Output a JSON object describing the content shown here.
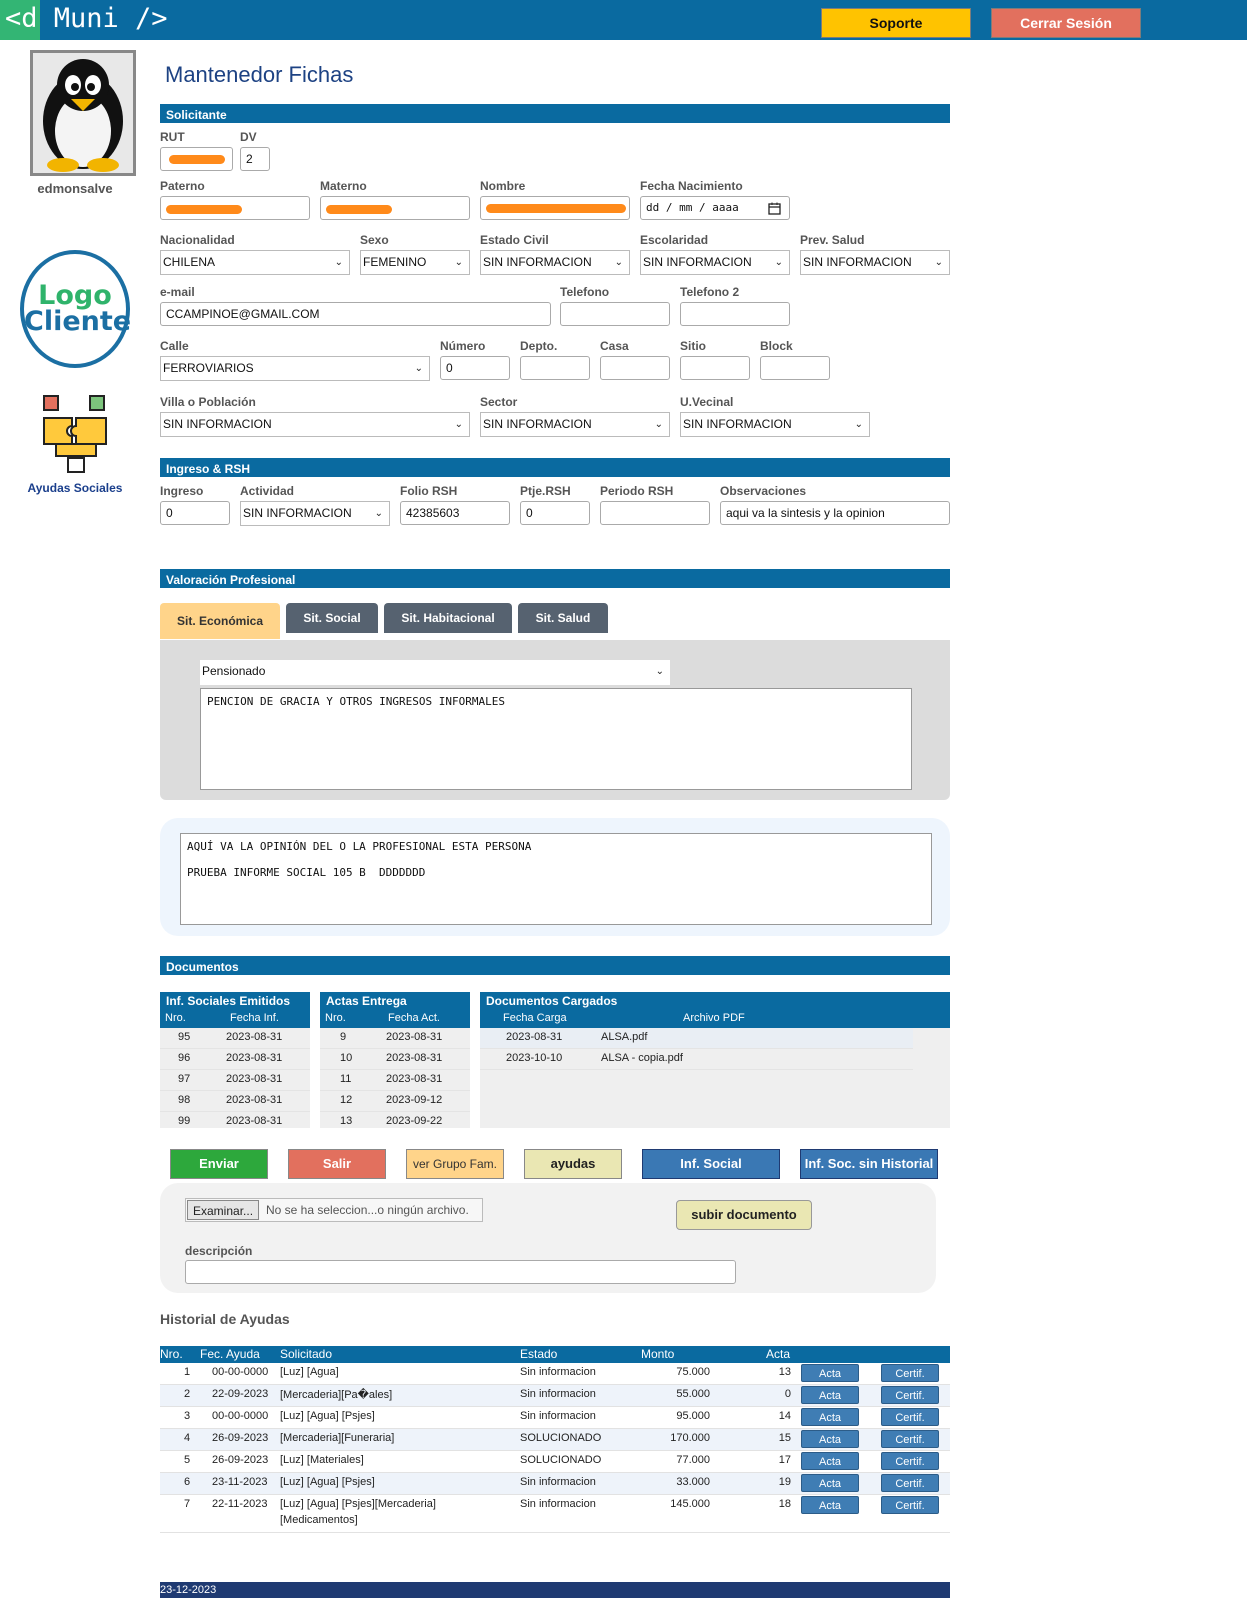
{
  "app": {
    "logo": "<d Muni />",
    "support_label": "Soporte",
    "logout_label": "Cerrar Sesión",
    "username": "edmonsalve",
    "client_logo_line1": "Logo",
    "client_logo_line2": "Cliente",
    "ayudas_label": "Ayudas Sociales",
    "brand_color": "#0a6aa0"
  },
  "page_title": "Mantenedor Fichas",
  "solicitante": {
    "section": "Solicitante",
    "rut_label": "RUT",
    "rut_value": "",
    "dv_label": "DV",
    "dv_value": "2",
    "paterno_label": "Paterno",
    "paterno_value": "",
    "materno_label": "Materno",
    "materno_value": "",
    "nombre_label": "Nombre",
    "nombre_value": "",
    "fecha_label": "Fecha Nacimiento",
    "fecha_placeholder": "dd / mm / aaaa",
    "nacionalidad_label": "Nacionalidad",
    "nacionalidad_value": "CHILENA",
    "sexo_label": "Sexo",
    "sexo_value": "FEMENINO",
    "estado_label": "Estado Civil",
    "estado_value": "SIN INFORMACION",
    "escolaridad_label": "Escolaridad",
    "escolaridad_value": "SIN INFORMACION",
    "prev_label": "Prev. Salud",
    "prev_value": "SIN INFORMACION",
    "email_label": "e-mail",
    "email_value": "CCAMPINOE@GMAIL.COM",
    "telefono_label": "Telefono",
    "telefono_value": "",
    "telefono2_label": "Telefono 2",
    "telefono2_value": "",
    "calle_label": "Calle",
    "calle_value": "FERROVIARIOS",
    "numero_label": "Número",
    "numero_value": "0",
    "depto_label": "Depto.",
    "casa_label": "Casa",
    "sitio_label": "Sitio",
    "block_label": "Block",
    "villa_label": "Villa o Población",
    "villa_value": "SIN INFORMACION",
    "sector_label": "Sector",
    "sector_value": "SIN INFORMACION",
    "uvecinal_label": "U.Vecinal",
    "uvecinal_value": "SIN INFORMACION"
  },
  "ingreso": {
    "section": "Ingreso & RSH",
    "ingreso_label": "Ingreso",
    "ingreso_value": "0",
    "actividad_label": "Actividad",
    "actividad_value": "SIN INFORMACION",
    "folio_label": "Folio RSH",
    "folio_value": "42385603",
    "ptje_label": "Ptje.RSH",
    "ptje_value": "0",
    "periodo_label": "Periodo RSH",
    "periodo_value": "",
    "obs_label": "Observaciones",
    "obs_value": "aqui va la sintesis y la opinion"
  },
  "valoracion": {
    "section": "Valoración Profesional",
    "tabs": [
      "Sit. Económica",
      "Sit. Social",
      "Sit. Habitacional",
      "Sit. Salud"
    ],
    "select_value": "Pensionado",
    "textarea_value": "PENCION DE GRACIA Y OTROS INGRESOS INFORMALES",
    "opinion_text": "AQUÍ VA LA OPINIÓN DEL O LA PROFESIONAL ESTA PERSONA\n\nPRUEBA INFORME SOCIAL 105 B  DDDDDDD"
  },
  "documentos": {
    "section": "Documentos",
    "informes": {
      "title": "Inf. Sociales Emitidos",
      "col_nro": "Nro.",
      "col_fecha": "Fecha Inf.",
      "rows": [
        [
          "95",
          "2023-08-31"
        ],
        [
          "96",
          "2023-08-31"
        ],
        [
          "97",
          "2023-08-31"
        ],
        [
          "98",
          "2023-08-31"
        ],
        [
          "99",
          "2023-08-31"
        ]
      ]
    },
    "actas": {
      "title": "Actas Entrega",
      "col_nro": "Nro.",
      "col_fecha": "Fecha Act.",
      "rows": [
        [
          "9",
          "2023-08-31"
        ],
        [
          "10",
          "2023-08-31"
        ],
        [
          "11",
          "2023-08-31"
        ],
        [
          "12",
          "2023-09-12"
        ],
        [
          "13",
          "2023-09-22"
        ]
      ]
    },
    "cargados": {
      "title": "Documentos Cargados",
      "col_fecha": "Fecha Carga",
      "col_archivo": "Archivo PDF",
      "rows": [
        [
          "2023-08-31",
          "ALSA.pdf"
        ],
        [
          "2023-10-10",
          "ALSA - copia.pdf"
        ]
      ]
    }
  },
  "actions": {
    "enviar": "Enviar",
    "salir": "Salir",
    "grupo": "ver Grupo Fam.",
    "ayudas": "ayudas",
    "inf_social": "Inf. Social",
    "inf_sin_hist": "Inf. Soc. sin Historial"
  },
  "upload": {
    "browse": "Examinar...",
    "no_file": "No se ha seleccion...o ningún archivo.",
    "subir": "subir documento",
    "desc_label": "descripción",
    "desc_value": ""
  },
  "historial": {
    "title": "Historial de Ayudas",
    "cols": [
      "Nro.",
      "Fec. Ayuda",
      "Solicitado",
      "Estado",
      "Monto",
      "Acta"
    ],
    "acta_btn": "Acta",
    "certif_btn": "Certif.",
    "rows": [
      [
        "1",
        "00-00-0000",
        "[Luz] [Agua]",
        "Sin informacion",
        "75.000",
        "13"
      ],
      [
        "2",
        "22-09-2023",
        "[Mercaderia][Pa�ales]",
        "Sin informacion",
        "55.000",
        "0"
      ],
      [
        "3",
        "00-00-0000",
        "[Luz] [Agua] [Psjes]",
        "Sin informacion",
        "95.000",
        "14"
      ],
      [
        "4",
        "26-09-2023",
        "[Mercaderia][Funeraria]",
        "SOLUCIONADO",
        "170.000",
        "15"
      ],
      [
        "5",
        "26-09-2023",
        "[Luz] [Materiales]",
        "SOLUCIONADO",
        "77.000",
        "17"
      ],
      [
        "6",
        "23-11-2023",
        "[Luz] [Agua] [Psjes]",
        "Sin informacion",
        "33.000",
        "19"
      ],
      [
        "7",
        "22-11-2023",
        "[Luz] [Agua] [Psjes][Mercaderia]",
        "Sin informacion",
        "145.000",
        "18"
      ]
    ],
    "row7_cont": "[Medicamentos]"
  },
  "footer_date": "23-12-2023"
}
